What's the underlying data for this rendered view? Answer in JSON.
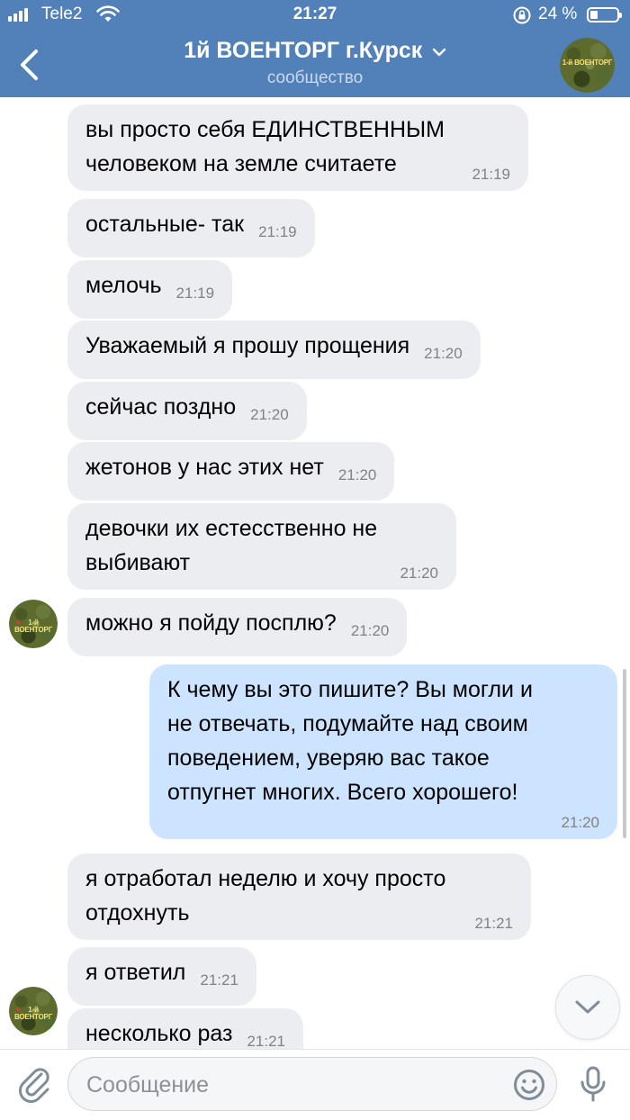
{
  "status_bar": {
    "carrier": "Tele2",
    "time": "21:27",
    "battery": "24 %"
  },
  "header": {
    "title": "1й ВОЕНТОРГ г.Курск",
    "subtitle": "сообщество",
    "avatar_text": "1-й ВОЕНТОРГ"
  },
  "messages": [
    {
      "text_lines": [
        "вы просто себя ЕДИНСТВЕННЫМ",
        "человеком на земле считаете"
      ],
      "time": "21:19",
      "side": "in"
    },
    {
      "text": "остальные- так",
      "time": "21:19",
      "side": "in"
    },
    {
      "text": "мелочь",
      "time": "21:19",
      "side": "in"
    },
    {
      "text": "Уважаемый я прошу прощения",
      "time": "21:20",
      "side": "in"
    },
    {
      "text": "сейчас поздно",
      "time": "21:20",
      "side": "in"
    },
    {
      "text": "жетонов у нас этих нет",
      "time": "21:20",
      "side": "in"
    },
    {
      "text_lines": [
        "девочки их естесственно не",
        "выбивают"
      ],
      "time": "21:20",
      "side": "in"
    },
    {
      "text": "можно я пойду посплю?",
      "time": "21:20",
      "side": "in"
    },
    {
      "text_lines": [
        "К чему вы это пишите? Вы могли и",
        "не отвечать, подумайте над своим",
        "поведением, уверяю вас такое",
        "отпугнет многих. Всего хорошего!"
      ],
      "time": "21:20",
      "side": "out"
    },
    {
      "text_lines": [
        "я отработал неделю и хочу просто",
        "отдохнуть"
      ],
      "time": "21:21",
      "side": "in"
    },
    {
      "text": "я ответил",
      "time": "21:21",
      "side": "in"
    },
    {
      "text": "несколько раз",
      "time": "21:21",
      "side": "in"
    }
  ],
  "composer": {
    "placeholder": "Сообщение"
  },
  "icons": {
    "back": "chevron-left-icon",
    "title_dropdown": "chevron-down-icon",
    "scroll_down": "chevron-down-icon",
    "attach": "paperclip-icon",
    "emoji": "smile-icon",
    "mic": "microphone-icon"
  },
  "colors": {
    "header": "#5181b8",
    "incoming_bubble": "#ebedf0",
    "outgoing_bubble": "#cce4ff",
    "timestamp": "#828282"
  }
}
